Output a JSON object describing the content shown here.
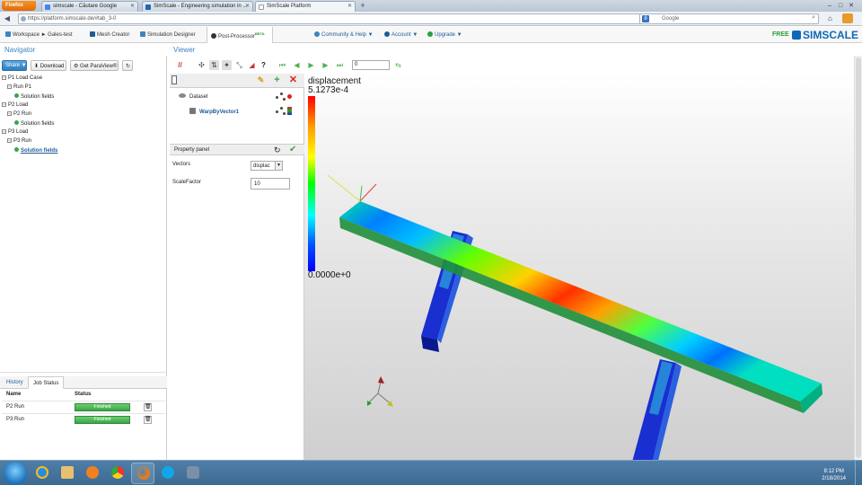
{
  "browser": {
    "app_button": "Firefox",
    "tabs": [
      {
        "title": "simscale - Căutare Google",
        "color": "#4285f4"
      },
      {
        "title": "SimScale - Engineering simulation in ...",
        "color": "#1b6ab0"
      },
      {
        "title": "SimScale Platform",
        "color": "#ffffff"
      }
    ],
    "url": "https://platform.simscale.de/#tab_3-0",
    "search_engine": "Google",
    "search_placeholder": "Google"
  },
  "app": {
    "breadcrumb": "Workspace ► Gales-test",
    "tabs": [
      {
        "label": "Mesh Creator",
        "icon": "grid-icon"
      },
      {
        "label": "Simulation Designer",
        "icon": "designer-icon"
      },
      {
        "label": "Post-Processor",
        "icon": "postprocessor-icon",
        "badge": "BETA"
      }
    ],
    "menus": [
      {
        "label": "Community & Help ▼",
        "icon": "community-icon"
      },
      {
        "label": "Account ▼",
        "icon": "account-icon"
      },
      {
        "label": "Upgrade ▼",
        "icon": "upgrade-icon"
      }
    ],
    "plan": "FREE",
    "logo": "SIMSCALE",
    "accent": "#3a84c0"
  },
  "navigator": {
    "title": "Navigator",
    "buttons": {
      "share": "Share ▼",
      "download": "Download",
      "paraview": "Get ParaView®"
    },
    "tree": [
      {
        "label": "P1 Load Case",
        "type": "folder"
      },
      {
        "label": "Run P1",
        "type": "run"
      },
      {
        "label": "Solution fields",
        "type": "result"
      },
      {
        "label": "P2 Load",
        "type": "folder"
      },
      {
        "label": "P2 Run",
        "type": "run"
      },
      {
        "label": "Solution fields",
        "type": "result"
      },
      {
        "label": "P3 Load",
        "type": "folder"
      },
      {
        "label": "P3 Run",
        "type": "run"
      },
      {
        "label": "Solution fields",
        "type": "result",
        "selected": true
      }
    ],
    "bottom_tabs": [
      "History",
      "Job Status"
    ],
    "jobs": {
      "headers": [
        "Name",
        "Status"
      ],
      "rows": [
        {
          "name": "P2 Run",
          "status": "Finished"
        },
        {
          "name": "P3 Run",
          "status": "Finished"
        }
      ]
    }
  },
  "viewer": {
    "title": "Viewer",
    "frame": "0",
    "pipeline": [
      {
        "label": "Dataset"
      },
      {
        "label": "WarpByVector1"
      }
    ],
    "property_panel": {
      "title": "Property panel",
      "fields": [
        {
          "label": "Vectors",
          "value": "displac"
        },
        {
          "label": "ScaleFactor",
          "value": "10"
        }
      ]
    },
    "legend": {
      "title": "displacement",
      "max": "5.1273e-4",
      "min": "0.0000e+0"
    }
  },
  "taskbar": {
    "time": "8:12 PM",
    "date": "2/18/2014"
  }
}
